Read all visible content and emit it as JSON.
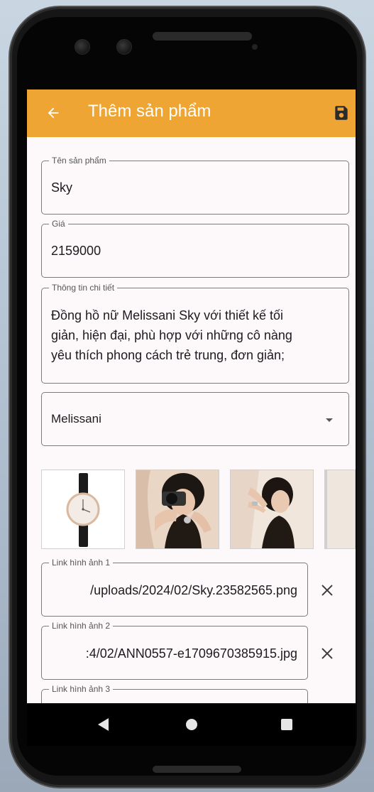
{
  "app_bar": {
    "title": "Thêm sản phẩm",
    "color": "#efa534",
    "back_icon": "arrow-back-icon",
    "save_icon": "save-floppy-icon"
  },
  "form": {
    "name_label": "Tên sản phẩm",
    "name_value": "Sky",
    "price_label": "Giá",
    "price_value": "2159000",
    "details_label": "Thông tin chi tiết",
    "details_lines": [
      "Đồng hồ nữ Melissani Sky với thiết kế tối",
      "giản, hiện đại, phù hợp với những cô nàng",
      "yêu thích phong cách trẻ trung, đơn giản;"
    ],
    "brand_value": "Melissani"
  },
  "images": {
    "thumbnails": [
      "watch-product-image",
      "woman-camera-image",
      "woman-watch-image",
      "partial-image"
    ],
    "links": [
      {
        "label": "Link hình ảnh 1",
        "value": "/uploads/2024/02/Sky.23582565.png"
      },
      {
        "label": "Link hình ảnh 2",
        "value": ":4/02/ANN0557-e1709670385915.jpg"
      },
      {
        "label": "Link hình ảnh 3",
        "value": ""
      }
    ]
  },
  "nav": {
    "back_icon": "nav-back-icon",
    "home_icon": "nav-home-icon",
    "recent_icon": "nav-recent-icon"
  }
}
